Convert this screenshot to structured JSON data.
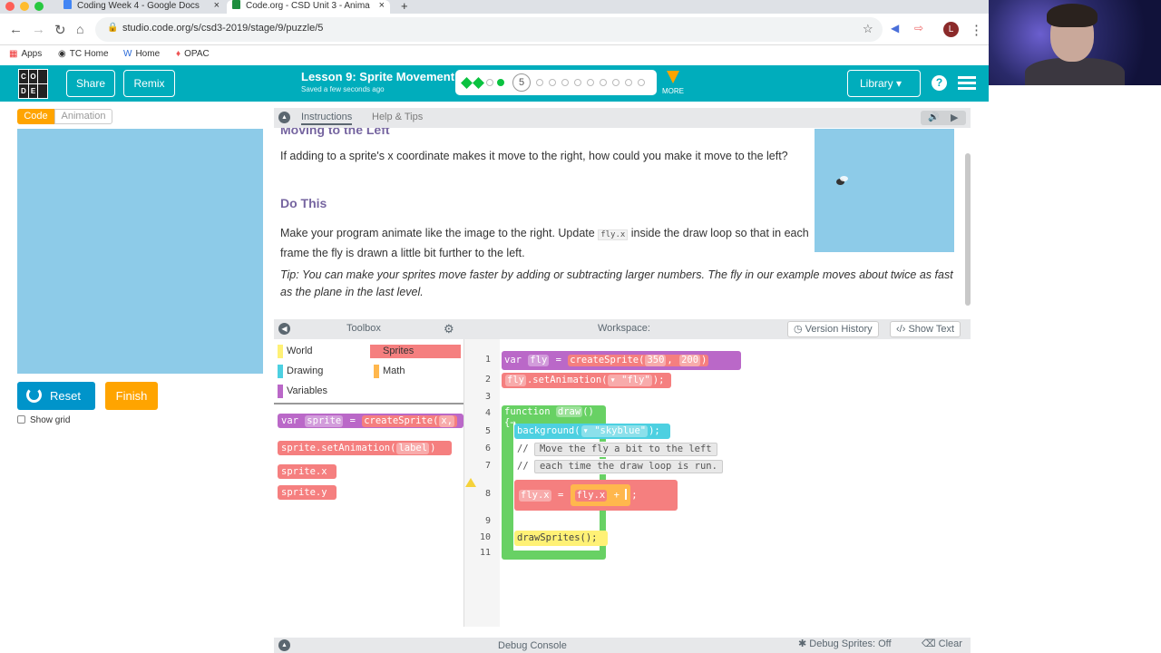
{
  "browser": {
    "tabs": [
      {
        "title": "Coding Week 4 - Google Docs",
        "favicon_color": "#4285f4"
      },
      {
        "title": "Code.org - CSD Unit 3 - Anima",
        "favicon_color": "#1e8e3e"
      }
    ],
    "new_tab": "+",
    "close": "×",
    "url": "studio.code.org/s/csd3-2019/stage/9/puzzle/5",
    "bookmarks": [
      "Apps",
      "TC Home",
      "Home",
      "OPAC"
    ],
    "avatar_letter": "L"
  },
  "header": {
    "logo_letters": [
      "C",
      "O",
      "",
      "D",
      "E",
      ""
    ],
    "share": "Share",
    "remix": "Remix",
    "lesson_title": "Lesson 9: Sprite Movement",
    "saved_status": "Saved a few seconds ago",
    "current_puzzle": "5",
    "more": "MORE",
    "library": "Library",
    "help": "?"
  },
  "left": {
    "code_tab": "Code",
    "animation_tab": "Animation",
    "reset": "Reset",
    "finish": "Finish",
    "show_grid": "Show grid"
  },
  "instructions": {
    "tab_instructions": "Instructions",
    "tab_help": "Help & Tips",
    "cut_heading": "Moving to the Left",
    "para1": "If adding to a sprite's x coordinate makes it move to the right, how could you make it move to the left?",
    "do_this": "Do This",
    "para2_pre": "Make your program animate like the image to the right. Update ",
    "para2_code": "fly.x",
    "para2_post": " inside the draw loop so that in each frame the fly is drawn a little bit further to the left.",
    "tip": "Tip: You can make your sprites move faster by adding or subtracting larger numbers. The fly in our example moves about twice as fast as the plane in the last level."
  },
  "toolbox": {
    "title": "Toolbox",
    "categories": [
      {
        "name": "World",
        "color": "#fff176"
      },
      {
        "name": "Sprites",
        "color": "#f57f7f"
      },
      {
        "name": "Drawing",
        "color": "#4dd0e1"
      },
      {
        "name": "Math",
        "color": "#ffb74d"
      },
      {
        "name": "Variables",
        "color": "#ba68c8"
      }
    ],
    "blocks": {
      "var_kw": "var",
      "var_name": "sprite",
      "eq": "=",
      "create": "createSprite",
      "create_arg": "x,",
      "set_anim_obj": "sprite",
      "set_anim": ".setAnimation",
      "set_anim_arg": "label",
      "sprite_x": "sprite.x",
      "sprite_y": "sprite.y"
    }
  },
  "workspace": {
    "title": "Workspace:",
    "version_history": "Version History",
    "show_text": "Show Text",
    "line_numbers": [
      "1",
      "2",
      "3",
      "4",
      "5",
      "6",
      "7",
      "8",
      "9",
      "10",
      "11"
    ],
    "code": {
      "l1_var": "var",
      "l1_name": "fly",
      "l1_eq": "=",
      "l1_fn": "createSprite",
      "l1_a1": "350",
      "l1_a2": "200",
      "l2_obj": "fly",
      "l2_fn": ".setAnimation",
      "l2_arg": "▾ \"fly\"",
      "l2_end": ";",
      "l4_kw": "function",
      "l4_name": "draw",
      "l4_paren": "()",
      "l5_fn": "background",
      "l5_arg": "▾ \"skyblue\"",
      "l5_end": ";",
      "l6_comment": "Move the fly a bit to the left",
      "l7_comment": "each time the draw loop is run.",
      "l8_lhs_obj": "fly",
      "l8_lhs_prop": ".x",
      "l8_eq": "=",
      "l8_rhs_obj": "fly",
      "l8_rhs_prop": ".x",
      "l8_op": "+",
      "l8_end": ";",
      "l10_fn": "drawSprites();",
      "slash": "//"
    }
  },
  "debug": {
    "title": "Debug Console",
    "debug_sprites": "Debug Sprites: Off",
    "clear": "Clear"
  },
  "colors": {
    "header_teal": "#00adbc",
    "orange": "#ffa400",
    "blue_button": "#0094ca",
    "stage": "#8dcbe8",
    "sprite_block": "#f57f7f",
    "drawing_block": "#4dd0e1",
    "variables_block": "#ba68c8",
    "math_block": "#ffb74d",
    "function_block": "#68d164",
    "world_block": "#fff176"
  }
}
